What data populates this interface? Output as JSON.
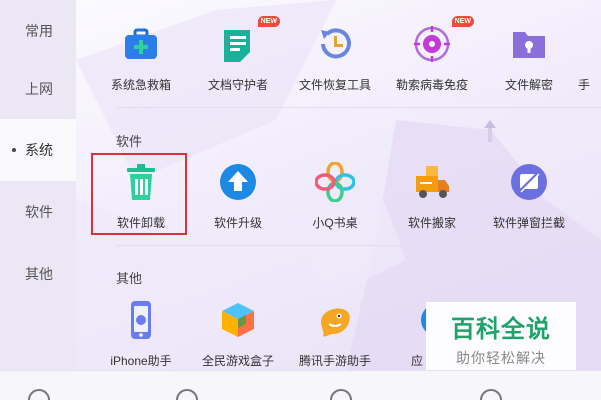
{
  "sidebar": {
    "items": [
      {
        "label": "常用"
      },
      {
        "label": "上网"
      },
      {
        "label": "系统"
      },
      {
        "label": "软件"
      },
      {
        "label": "其他"
      }
    ],
    "active_index": 2
  },
  "top_row": {
    "items": [
      {
        "label": "系统急救箱",
        "icon": "first-aid-kit-icon",
        "badge": ""
      },
      {
        "label": "文档守护者",
        "icon": "document-guard-icon",
        "badge": "NEW"
      },
      {
        "label": "文件恢复工具",
        "icon": "file-restore-icon",
        "badge": ""
      },
      {
        "label": "勒索病毒免疫",
        "icon": "virus-immune-icon",
        "badge": "NEW"
      },
      {
        "label": "文件解密",
        "icon": "folder-lock-icon",
        "badge": ""
      },
      {
        "label": "手",
        "icon": "",
        "badge": ""
      }
    ]
  },
  "software": {
    "title": "软件",
    "items": [
      {
        "label": "软件卸载",
        "icon": "trash-icon"
      },
      {
        "label": "软件升级",
        "icon": "upgrade-arrow-icon"
      },
      {
        "label": "小Q书桌",
        "icon": "pinwheel-icon"
      },
      {
        "label": "软件搬家",
        "icon": "moving-truck-icon"
      },
      {
        "label": "软件弹窗拦截",
        "icon": "popup-block-icon"
      }
    ]
  },
  "other": {
    "title": "其他",
    "items": [
      {
        "label": "iPhone助手",
        "icon": "iphone-icon"
      },
      {
        "label": "全民游戏盒子",
        "icon": "game-box-icon"
      },
      {
        "label": "腾讯手游助手",
        "icon": "game-fish-icon"
      },
      {
        "label": "应",
        "icon": ""
      }
    ]
  },
  "watermark": {
    "main": "百科全说",
    "sub": "助你轻松解决"
  },
  "colors": {
    "highlight": "#d9323a",
    "watermark_green": "#1fa36a"
  }
}
